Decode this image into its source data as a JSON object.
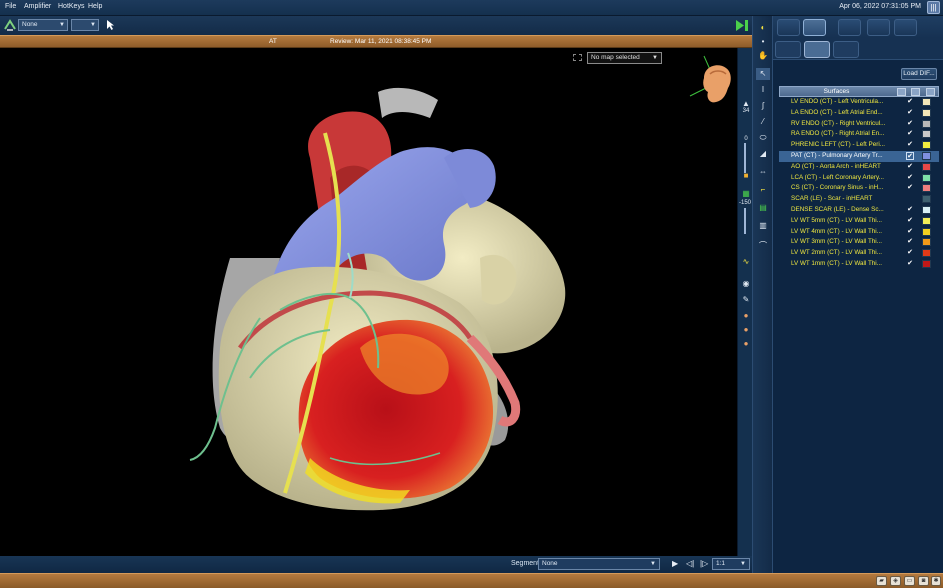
{
  "menu": {
    "file": "File",
    "amplifier": "Amplifier",
    "hotkeys": "HotKeys",
    "help": "Help"
  },
  "clock": "Apr 06, 2022 07:31:05 PM",
  "toolbar": {
    "select1": "None",
    "select2": ""
  },
  "title_strip": {
    "map": "AT",
    "review": "Review: Mar 11, 2021 08:38:45 PM"
  },
  "viewport": {
    "map_select": "No map selected"
  },
  "vtools": {
    "label_34": "34",
    "label_0": "0",
    "label_neg150": "-150"
  },
  "segment": {
    "label": "Segment",
    "value": "None",
    "zoom": "1:1"
  },
  "panel": {
    "load_button": "Load DIF...",
    "surfaces_header": "Surfaces",
    "surfaces": [
      {
        "name": "LV ENDO (CT) - Left Ventricula...",
        "checked": true,
        "color": "#f2e6b8"
      },
      {
        "name": "LA ENDO (CT) - Left Atrial End...",
        "checked": true,
        "color": "#f2e6b8"
      },
      {
        "name": "RV ENDO (CT) - Right Ventricul...",
        "checked": true,
        "color": "#b8b8b8"
      },
      {
        "name": "RA ENDO (CT) - Right Atrial En...",
        "checked": true,
        "color": "#c8c8c8"
      },
      {
        "name": "PHRENIC LEFT (CT) - Left Peri...",
        "checked": true,
        "color": "#f0ec40"
      },
      {
        "name": "PAT (CT) - Pulmonary Artery Tr...",
        "checked": true,
        "color": "#7f8fe0",
        "selected": true
      },
      {
        "name": "AO (CT) - Aorta Arch - inHEART",
        "checked": true,
        "color": "#e84848"
      },
      {
        "name": "LCA (CT) - Left Coronary Artery...",
        "checked": true,
        "color": "#7ee0a8"
      },
      {
        "name": "CS (CT) - Coronary Sinus - inH...",
        "checked": true,
        "color": "#f07e7e"
      },
      {
        "name": "SCAR (LE) - Scar - inHEART",
        "checked": false,
        "color": "#3e6070"
      },
      {
        "name": "DENSE SCAR (LE) - Dense Sc...",
        "checked": true,
        "color": "#d8f0f6"
      },
      {
        "name": "LV WT 5mm (CT) - LV Wall Thi...",
        "checked": true,
        "color": "#f2ee58"
      },
      {
        "name": "LV WT 4mm (CT) - LV Wall Thi...",
        "checked": true,
        "color": "#f4d020"
      },
      {
        "name": "LV WT 3mm (CT) - LV Wall Thi...",
        "checked": true,
        "color": "#f29a18"
      },
      {
        "name": "LV WT 2mm (CT) - LV Wall Thi...",
        "checked": true,
        "color": "#e23a18"
      },
      {
        "name": "LV WT 1mm (CT) - LV Wall Thi...",
        "checked": true,
        "color": "#c01818"
      }
    ]
  },
  "icons": {
    "logo": "app-logo-icon",
    "pointer": "cursor-icon",
    "orientation": "orientation-head-icon"
  }
}
